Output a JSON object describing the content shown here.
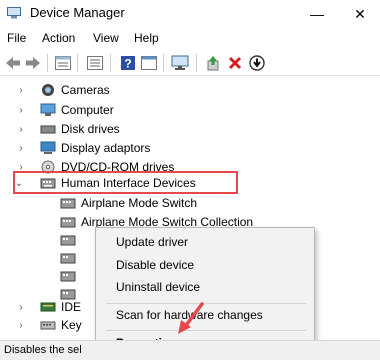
{
  "window": {
    "title": "Device Manager",
    "minimize_glyph": "—",
    "close_glyph": "✕"
  },
  "menu": {
    "items": [
      "File",
      "Action",
      "View",
      "Help"
    ]
  },
  "toolbar": {
    "buttons": [
      "back-arrow-icon",
      "forward-arrow-icon",
      "properties-view-icon",
      "panel-icon",
      "help-icon",
      "window-icon",
      "monitor-icon",
      "update-driver-icon",
      "uninstall-x-icon",
      "disable-down-icon"
    ]
  },
  "tree": {
    "items": [
      {
        "label": "Cameras",
        "icon": "camera-icon",
        "expanded": false
      },
      {
        "label": "Computer",
        "icon": "computer-icon",
        "expanded": false
      },
      {
        "label": "Disk drives",
        "icon": "disk-drive-icon",
        "expanded": false
      },
      {
        "label": "Display adaptors",
        "icon": "display-adapter-icon",
        "expanded": false
      },
      {
        "label": "DVD/CD-ROM drives",
        "icon": "dvd-icon",
        "expanded": false
      },
      {
        "label": "Human Interface Devices",
        "icon": "hid-icon",
        "expanded": true
      }
    ],
    "children": [
      {
        "label": "Airplane Mode Switch",
        "icon": "hid-device-icon"
      },
      {
        "label": "Airplane Mode Switch Collection",
        "icon": "hid-device-icon"
      }
    ],
    "partial_items": [
      {
        "label": "IDE",
        "icon": "ide-icon"
      },
      {
        "label": "Key",
        "icon": "keyboard-icon"
      }
    ],
    "highlight_color": "#e8474c"
  },
  "context_menu": {
    "items": [
      {
        "label": "Update driver"
      },
      {
        "label": "Disable device"
      },
      {
        "label": "Uninstall device"
      },
      {
        "label": "Scan for hardware changes"
      },
      {
        "label": "Properties"
      }
    ]
  },
  "status_bar": {
    "text": "Disables the sel"
  },
  "accent_colors": {
    "annotation_red": "#e8474c"
  }
}
